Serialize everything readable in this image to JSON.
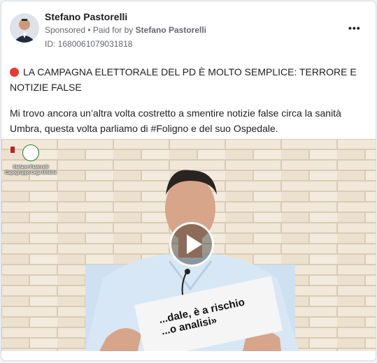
{
  "post": {
    "author": "Stefano Pastorelli",
    "sponsored": "Sponsored",
    "paid_for_prefix": "• Paid for by",
    "paid_for": "Stefano Pastorelli",
    "id_label": "ID: 1680061079031818",
    "menu_label": "•••",
    "headline": "LA CAMPAGNA ELETTORALE DEL PD È MOLTO SEMPLICE: TERRORE E NOTIZIE FALSE",
    "body": "Mi trovo ancora un’altra volta costretto a smentire notizie false circa la sanità Umbra, questa volta parliamo di #Foligno e del suo Ospedale."
  },
  "video": {
    "overlay_name": "Stefano Pastorelli",
    "overlay_role": "Capogruppo Lega Umbria",
    "sheet_text_1": "...dale, è a rischio",
    "sheet_text_2": "...o analisi»"
  },
  "colors": {
    "alert_dot": "#e53935",
    "brick": "#efe6d6"
  }
}
